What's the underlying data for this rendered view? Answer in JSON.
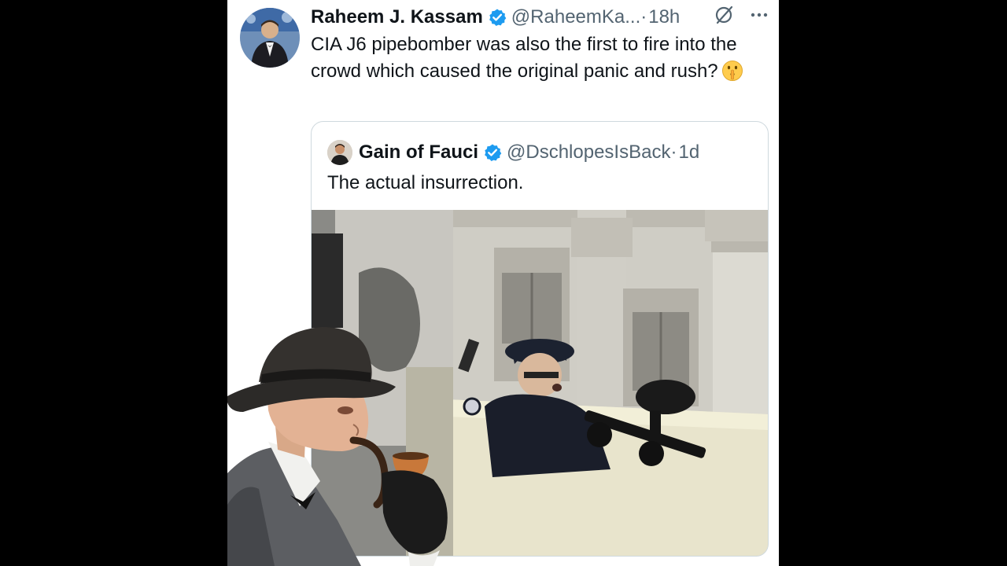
{
  "tweet": {
    "author_name": "Raheem J. Kassam",
    "handle": "@RaheemKa...",
    "separator": "·",
    "time": "18h",
    "text": "CIA J6 pipebomber was also the first to fire into the crowd which caused the original panic and rush?",
    "emoji": "shushing-face-emoji"
  },
  "quote": {
    "author_name": "Gain of Fauci",
    "handle": "@DschlopesIsBack",
    "separator": "·",
    "time": "1d",
    "text": "The actual insurrection."
  },
  "icons": {
    "verified": "verified-badge-icon",
    "grok": "grok-icon",
    "more": "more-icon"
  },
  "colors": {
    "verified_blue": "#1d9bf0",
    "text_primary": "#0f1419",
    "text_secondary": "#536471",
    "border": "#cfd9de"
  }
}
